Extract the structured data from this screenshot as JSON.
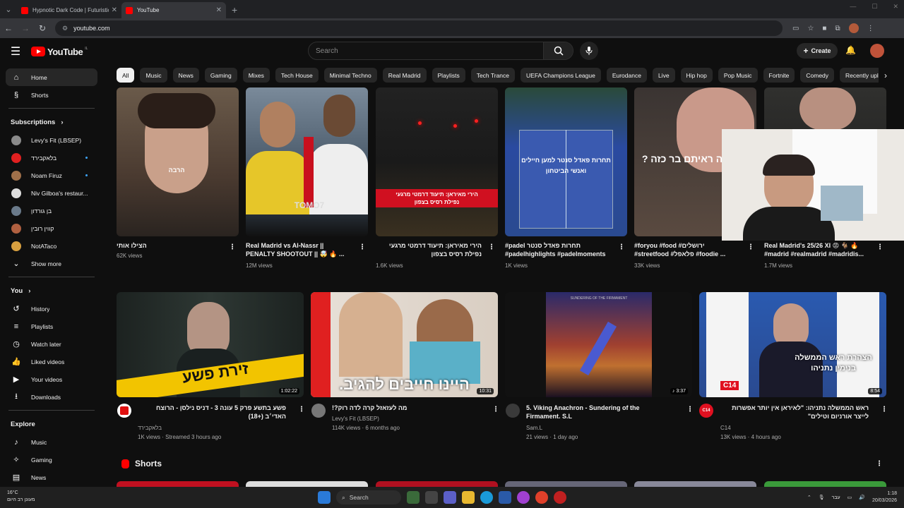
{
  "browser": {
    "tabs": [
      {
        "title": "Hypnotic Dark Code | Futuristic"
      },
      {
        "title": "YouTube"
      }
    ],
    "url": "youtube.com"
  },
  "header": {
    "logo_text": "YouTube",
    "logo_country": "IL",
    "search_placeholder": "Search",
    "create_label": "Create"
  },
  "sidebar": {
    "main": [
      {
        "label": "Home",
        "icon": "home-icon"
      },
      {
        "label": "Shorts",
        "icon": "shorts-icon"
      }
    ],
    "subscriptions_title": "Subscriptions",
    "subscriptions": [
      {
        "label": "Levy's Fit (LBSEP)",
        "color": "#8a8a8a",
        "dot": false
      },
      {
        "label": "בלאקבירד",
        "color": "#e02020",
        "dot": true
      },
      {
        "label": "Noam Firuz",
        "color": "#a0704a",
        "dot": true
      },
      {
        "label": "Niv Gilboa's restaur...",
        "color": "#dddddd",
        "dot": false
      },
      {
        "label": "בן גורדון",
        "color": "#6a7a8a",
        "dot": false
      },
      {
        "label": "קווין רובין",
        "color": "#b06040",
        "dot": false
      },
      {
        "label": "NotATaco",
        "color": "#d8a040",
        "dot": false
      }
    ],
    "show_more": "Show more",
    "you_title": "You",
    "you": [
      {
        "label": "History",
        "icon": "history-icon"
      },
      {
        "label": "Playlists",
        "icon": "playlists-icon"
      },
      {
        "label": "Watch later",
        "icon": "watch-later-icon"
      },
      {
        "label": "Liked videos",
        "icon": "liked-icon"
      },
      {
        "label": "Your videos",
        "icon": "your-videos-icon"
      },
      {
        "label": "Downloads",
        "icon": "downloads-icon"
      }
    ],
    "explore_title": "Explore",
    "explore": [
      {
        "label": "Music",
        "icon": "music-icon"
      },
      {
        "label": "Gaming",
        "icon": "gaming-icon"
      },
      {
        "label": "News",
        "icon": "news-icon"
      }
    ]
  },
  "chips": [
    "All",
    "Music",
    "News",
    "Gaming",
    "Mixes",
    "Tech House",
    "Minimal Techno",
    "Real Madrid",
    "Playlists",
    "Tech Trance",
    "UEFA Champions League",
    "Eurodance",
    "Live",
    "Hip hop",
    "Pop Music",
    "Fortnite",
    "Comedy",
    "Recently uploaded"
  ],
  "row1": [
    {
      "title": "הצילו אותי",
      "line2": "",
      "meta": "62K views",
      "overlay": "הרבה"
    },
    {
      "title": "Real Madrid vs Al-Nassr || PENALTY SHOOTOUT || 🤯 🔥 ...",
      "meta": "12M views",
      "overlay": "TOMO7"
    },
    {
      "title": "הירי מאיראן: תיעוד דרמטי מרגעי נפילת רסיס בצפון",
      "meta": "1.6K views",
      "overlay": "הירי מאיראן: תיעוד דרמטי מרגעי נפילת רסיס בצפון"
    },
    {
      "title": "#padel תחרות פאדל סנטר #padelhighlights #padelmoments",
      "meta": "1K views",
      "overlay": "תחרות פאדל סנטר למען חיילים ואנשי הביטחון"
    },
    {
      "title": "#foryou #food #ירושלים #streetfood #פלאפל #foodie ...",
      "meta": "33K views",
      "overlay": "יה ראיתם בר כזה ?"
    },
    {
      "title": "Real Madrid's 25/26 XI 😡 🐐 🔥 #madrid #realmadrid #madridis...",
      "meta": "1.7M views",
      "overlay": ""
    }
  ],
  "row2": [
    {
      "title": "פשע בתשע פרק 5 עונה 3 - דניס נילסן - הרוצח האדי׳ב (+18)",
      "channel": "בלאקבירד",
      "meta": "1K views · Streamed 3 hours ago",
      "duration": "1:02:22",
      "overlay": "זירת פשע"
    },
    {
      "title": "מה לעזאזל קרה לדה רוק?!",
      "channel": "Levy's Fit (LBSEP)",
      "meta": "114K views · 6 months ago",
      "duration": "10:31",
      "overlay": "היינו חייבים להגיב."
    },
    {
      "title": "5. Viking Anachron - Sundering of the Firmament.  S.L",
      "channel": "Sam.L",
      "meta": "21 views · 1 day ago",
      "duration": "3:37",
      "overlay": "SUNDERING OF THE FIRMAMENT"
    },
    {
      "title": "ראש הממשלה נתניהו: \"לאיראן אין יותר אפשרות לייצר אורניום וטילים\"",
      "channel": "C14",
      "meta": "13K views · 4 hours ago",
      "duration": "8:54",
      "overlay": "הצהרת ראש הממשלה בנימין נתניהו",
      "badge": "C14"
    }
  ],
  "shorts_title": "Shorts",
  "taskbar": {
    "temp": "16°C",
    "weather": "מעונן רב היום",
    "search": "Search",
    "lang": "עבר",
    "time": "1:18",
    "date": "20/03/2026"
  }
}
